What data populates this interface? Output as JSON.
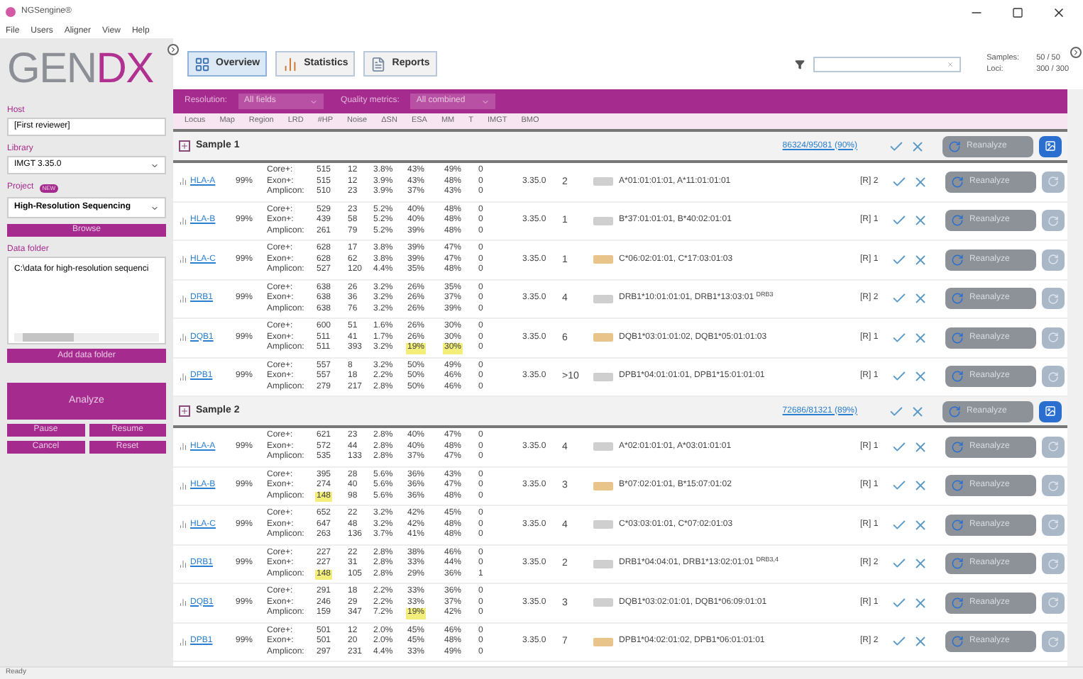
{
  "window": {
    "title": "NGSengine®"
  },
  "menu": [
    "File",
    "Users",
    "Aligner",
    "View",
    "Help"
  ],
  "sidebar": {
    "logo_gray": "GEN",
    "logo_color": "DX",
    "reviewer": {
      "label": "Host",
      "value": "[First reviewer]"
    },
    "library": {
      "label": "Library",
      "value": "IMGT 3.35.0"
    },
    "project": {
      "label": "Project",
      "badge": "NEW",
      "value": "High-Resolution Sequencing"
    },
    "browse": "Browse",
    "data_folder": {
      "label": "Data folder",
      "value": "C:\\data for high-resolution sequenci"
    },
    "add_folder": "Add data folder",
    "analyze": "Analyze",
    "buttons": [
      "Pause",
      "Resume",
      "Cancel",
      "Reset"
    ]
  },
  "tabs": [
    {
      "label": "Overview",
      "selected": true
    },
    {
      "label": "Statistics",
      "selected": false
    },
    {
      "label": "Reports",
      "selected": false
    }
  ],
  "counts": [
    {
      "label": "Samples:",
      "value": "50 / 50"
    },
    {
      "label": "Loci:",
      "value": "300 / 300"
    }
  ],
  "filters": [
    {
      "label": "Resolution:",
      "value": "All fields"
    },
    {
      "label": "Quality metrics:",
      "value": "All combined"
    }
  ],
  "columns": [
    "Locus",
    "Map",
    "Region",
    "LRD",
    "#HP",
    "Noise",
    "ΔSN",
    "ESA",
    "MM",
    "T",
    "IMGT",
    "BMO"
  ],
  "samples": [
    {
      "name": "Sample 1",
      "reads": "86324/95081 (90%)",
      "button": "Reanalyze",
      "loci": [
        {
          "locus": "HLA-A",
          "map": "99%",
          "imgt": "3.35.0",
          "count": "2",
          "color": "#cfcfcf",
          "button": "Reanalyze",
          "alleles": "A*01:01:01:01, A*11:01:01:01",
          "review": "[R] 2",
          "lines": [
            {
              "region": "Core+:",
              "lrd": "515",
              "hp": "12",
              "noise": "3.8%",
              "dsn": "43%",
              "esa": "49%",
              "mm": "0"
            },
            {
              "region": "Exon+:",
              "lrd": "515",
              "hp": "12",
              "noise": "3.9%",
              "dsn": "43%",
              "esa": "48%",
              "mm": "0"
            },
            {
              "region": "Amplicon:",
              "lrd": "510",
              "hp": "23",
              "noise": "3.9%",
              "dsn": "37%",
              "esa": "43%",
              "mm": "0"
            }
          ]
        },
        {
          "locus": "HLA-B",
          "map": "99%",
          "imgt": "3.35.0",
          "count": "1",
          "color": "#cfcfcf",
          "button": "Reanalyze",
          "alleles": "B*37:01:01:01, B*40:02:01:01",
          "review": "[R] 1",
          "lines": [
            {
              "region": "Core+:",
              "lrd": "529",
              "hp": "23",
              "noise": "5.2%",
              "dsn": "40%",
              "esa": "48%",
              "mm": "0"
            },
            {
              "region": "Exon+:",
              "lrd": "439",
              "hp": "58",
              "noise": "5.2%",
              "dsn": "40%",
              "esa": "48%",
              "mm": "0"
            },
            {
              "region": "Amplicon:",
              "lrd": "261",
              "hp": "79",
              "noise": "5.2%",
              "dsn": "39%",
              "esa": "48%",
              "mm": "0"
            }
          ]
        },
        {
          "locus": "HLA-C",
          "map": "99%",
          "imgt": "3.35.0",
          "count": "1",
          "color": "#e8c48a",
          "button": "Reanalyze",
          "alleles": "C*06:02:01:01, C*17:03:01:03",
          "review": "[R] 1",
          "lines": [
            {
              "region": "Core+:",
              "lrd": "628",
              "hp": "17",
              "noise": "3.8%",
              "dsn": "39%",
              "esa": "47%",
              "mm": "0"
            },
            {
              "region": "Exon+:",
              "lrd": "628",
              "hp": "62",
              "noise": "3.8%",
              "dsn": "39%",
              "esa": "47%",
              "mm": "0"
            },
            {
              "region": "Amplicon:",
              "lrd": "527",
              "hp": "120",
              "noise": "4.4%",
              "dsn": "35%",
              "esa": "48%",
              "mm": "0"
            }
          ]
        },
        {
          "locus": "DRB1",
          "map": "99%",
          "imgt": "3.35.0",
          "count": "4",
          "color": "#cfcfcf",
          "button": "Reanalyze",
          "alleles": "DRB1*10:01:01:01, DRB1*13:03:01 $^{DRB3}$",
          "review": "[R] 2",
          "lines": [
            {
              "region": "Core+:",
              "lrd": "638",
              "hp": "26",
              "noise": "3.2%",
              "dsn": "26%",
              "esa": "35%",
              "mm": "0"
            },
            {
              "region": "Exon+:",
              "lrd": "638",
              "hp": "36",
              "noise": "3.2%",
              "dsn": "26%",
              "esa": "37%",
              "mm": "0"
            },
            {
              "region": "Amplicon:",
              "lrd": "638",
              "hp": "76",
              "noise": "3.2%",
              "dsn": "26%",
              "esa": "39%",
              "mm": "0"
            }
          ]
        },
        {
          "locus": "DQB1",
          "map": "99%",
          "imgt": "3.35.0",
          "count": "6",
          "color": "#e8c48a",
          "button": "Reanalyze",
          "alleles": "DQB1*03:01:01:02, DQB1*05:01:01:03",
          "review": "[R] 1",
          "lines": [
            {
              "region": "Core+:",
              "lrd": "600",
              "hp": "51",
              "noise": "1.6%",
              "dsn": "26%",
              "esa": "30%",
              "mm": "0"
            },
            {
              "region": "Exon+:",
              "lrd": "511",
              "hp": "41",
              "noise": "1.7%",
              "dsn": "26%",
              "esa": "30%",
              "mm": "0"
            },
            {
              "region": "Amplicon:",
              "lrd": "511",
              "hp": "393",
              "noise": "3.2%",
              "dsn": "19%",
              "esa": "30%",
              "mm": "0",
              "flagged": {
                "dsn": true,
                "esa": true
              }
            }
          ]
        },
        {
          "locus": "DPB1",
          "map": "99%",
          "imgt": "3.35.0",
          "count": ">10",
          "color": "#cfcfcf",
          "button": "Reanalyze",
          "alleles": "DPB1*04:01:01:01, DPB1*15:01:01:01",
          "review": "[R] 1",
          "lines": [
            {
              "region": "Core+:",
              "lrd": "557",
              "hp": "8",
              "noise": "3.2%",
              "dsn": "50%",
              "esa": "49%",
              "mm": "0"
            },
            {
              "region": "Exon+:",
              "lrd": "557",
              "hp": "18",
              "noise": "2.2%",
              "dsn": "50%",
              "esa": "46%",
              "mm": "0"
            },
            {
              "region": "Amplicon:",
              "lrd": "279",
              "hp": "217",
              "noise": "2.8%",
              "dsn": "50%",
              "esa": "46%",
              "mm": "0"
            }
          ]
        }
      ]
    },
    {
      "name": "Sample 2",
      "reads": "72686/81321 (89%)",
      "button": "Reanalyze",
      "loci": [
        {
          "locus": "HLA-A",
          "map": "99%",
          "imgt": "3.35.0",
          "count": "4",
          "color": "#cfcfcf",
          "button": "Reanalyze",
          "alleles": "A*02:01:01:01, A*03:01:01:01",
          "review": "[R] 1",
          "lines": [
            {
              "region": "Core+:",
              "lrd": "621",
              "hp": "23",
              "noise": "2.8%",
              "dsn": "40%",
              "esa": "47%",
              "mm": "0"
            },
            {
              "region": "Exon+:",
              "lrd": "572",
              "hp": "44",
              "noise": "2.8%",
              "dsn": "40%",
              "esa": "48%",
              "mm": "0"
            },
            {
              "region": "Amplicon:",
              "lrd": "535",
              "hp": "133",
              "noise": "2.8%",
              "dsn": "37%",
              "esa": "47%",
              "mm": "0"
            }
          ]
        },
        {
          "locus": "HLA-B",
          "map": "99%",
          "imgt": "3.35.0",
          "count": "3",
          "color": "#e8c48a",
          "button": "Reanalyze",
          "alleles": "B*07:02:01:01, B*15:07:01:02",
          "review": "[R] 1",
          "lines": [
            {
              "region": "Core+:",
              "lrd": "395",
              "hp": "28",
              "noise": "5.6%",
              "dsn": "36%",
              "esa": "43%",
              "mm": "0"
            },
            {
              "region": "Exon+:",
              "lrd": "274",
              "hp": "40",
              "noise": "5.6%",
              "dsn": "36%",
              "esa": "47%",
              "mm": "0"
            },
            {
              "region": "Amplicon:",
              "lrd": "148",
              "hp": "98",
              "noise": "5.6%",
              "dsn": "36%",
              "esa": "48%",
              "mm": "0",
              "flagged": {
                "lrd": true
              }
            }
          ]
        },
        {
          "locus": "HLA-C",
          "map": "99%",
          "imgt": "3.35.0",
          "count": "4",
          "color": "#cfcfcf",
          "button": "Reanalyze",
          "alleles": "C*03:03:01:01, C*07:02:01:03",
          "review": "[R] 1",
          "lines": [
            {
              "region": "Core+:",
              "lrd": "652",
              "hp": "22",
              "noise": "3.2%",
              "dsn": "42%",
              "esa": "45%",
              "mm": "0"
            },
            {
              "region": "Exon+:",
              "lrd": "647",
              "hp": "48",
              "noise": "3.2%",
              "dsn": "42%",
              "esa": "48%",
              "mm": "0"
            },
            {
              "region": "Amplicon:",
              "lrd": "263",
              "hp": "136",
              "noise": "3.7%",
              "dsn": "41%",
              "esa": "48%",
              "mm": "0"
            }
          ]
        },
        {
          "locus": "DRB1",
          "map": "99%",
          "imgt": "3.35.0",
          "count": "2",
          "color": "#cfcfcf",
          "button": "Reanalyze",
          "alleles": "DRB1*04:04:01, DRB1*13:02:01:01 $^{DRB3,4}$",
          "review": "[R] 2",
          "lines": [
            {
              "region": "Core+:",
              "lrd": "227",
              "hp": "22",
              "noise": "2.8%",
              "dsn": "38%",
              "esa": "46%",
              "mm": "0"
            },
            {
              "region": "Exon+:",
              "lrd": "227",
              "hp": "31",
              "noise": "2.8%",
              "dsn": "33%",
              "esa": "44%",
              "mm": "0"
            },
            {
              "region": "Amplicon:",
              "lrd": "148",
              "hp": "105",
              "noise": "2.8%",
              "dsn": "29%",
              "esa": "36%",
              "mm": "1",
              "flagged": {
                "lrd": true
              }
            }
          ]
        },
        {
          "locus": "DQB1",
          "map": "99%",
          "imgt": "3.35.0",
          "count": "3",
          "color": "#cfcfcf",
          "button": "Reanalyze",
          "alleles": "DQB1*03:02:01:01, DQB1*06:09:01:01",
          "review": "[R] 1",
          "lines": [
            {
              "region": "Core+:",
              "lrd": "291",
              "hp": "18",
              "noise": "2.2%",
              "dsn": "33%",
              "esa": "36%",
              "mm": "0"
            },
            {
              "region": "Exon+:",
              "lrd": "246",
              "hp": "29",
              "noise": "2.2%",
              "dsn": "33%",
              "esa": "37%",
              "mm": "0"
            },
            {
              "region": "Amplicon:",
              "lrd": "159",
              "hp": "347",
              "noise": "7.2%",
              "dsn": "19%",
              "esa": "42%",
              "mm": "0",
              "flagged": {
                "dsn": true
              }
            }
          ]
        },
        {
          "locus": "DPB1",
          "map": "99%",
          "imgt": "3.35.0",
          "count": "7",
          "color": "#e8c48a",
          "button": "Reanalyze",
          "alleles": "DPB1*04:02:01:02, DPB1*06:01:01:01",
          "review": "[R] 2",
          "lines": [
            {
              "region": "Core+:",
              "lrd": "501",
              "hp": "12",
              "noise": "2.0%",
              "dsn": "45%",
              "esa": "46%",
              "mm": "0"
            },
            {
              "region": "Exon+:",
              "lrd": "501",
              "hp": "20",
              "noise": "2.0%",
              "dsn": "45%",
              "esa": "48%",
              "mm": "0"
            },
            {
              "region": "Amplicon:",
              "lrd": "297",
              "hp": "231",
              "noise": "4.4%",
              "dsn": "33%",
              "esa": "49%",
              "mm": "0"
            }
          ]
        }
      ]
    }
  ],
  "status_bar": "Ready"
}
